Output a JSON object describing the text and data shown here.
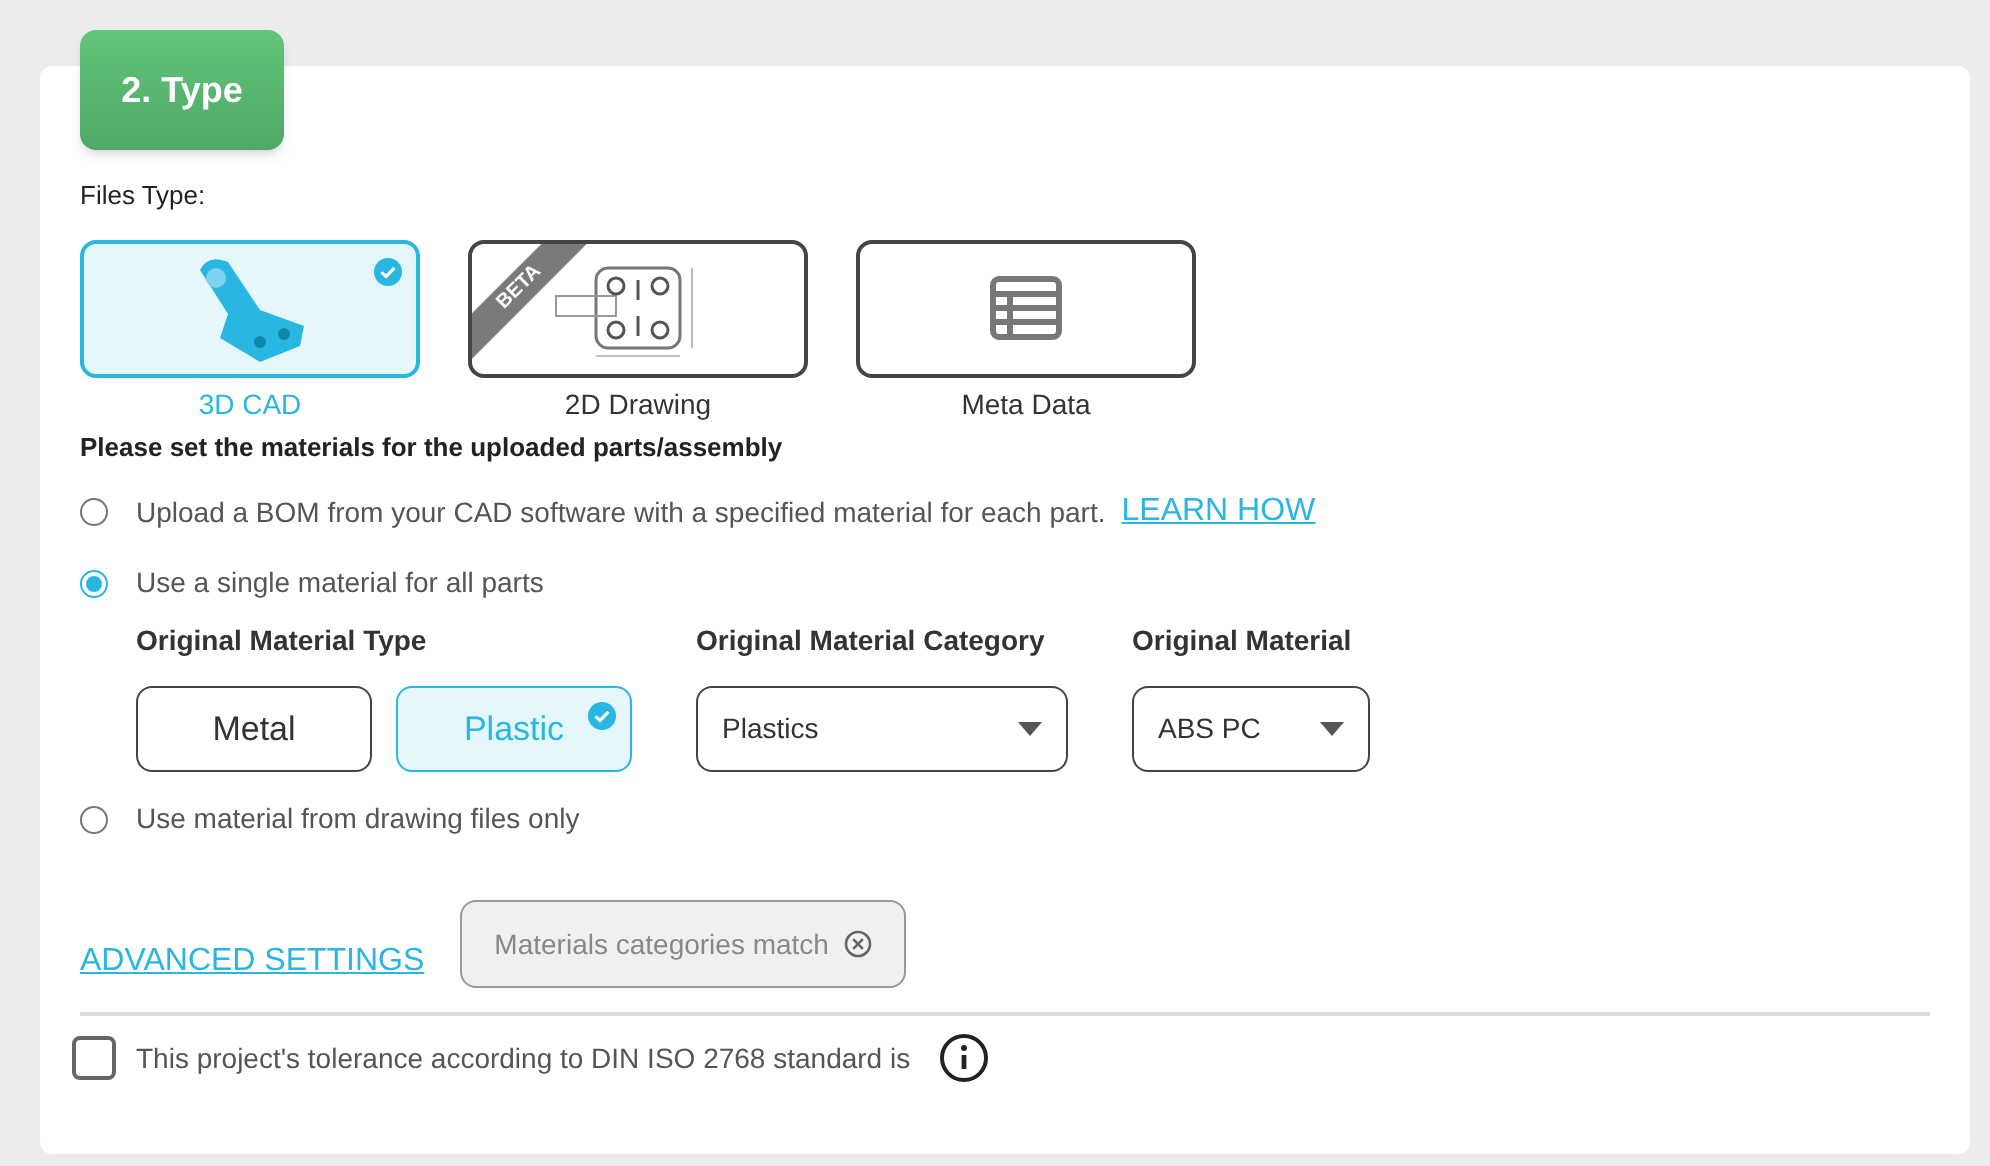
{
  "step_badge": "2. Type",
  "files_type_label": "Files Type:",
  "file_types": [
    {
      "label": "3D CAD",
      "kind": "model",
      "selected": true
    },
    {
      "label": "2D Drawing",
      "kind": "drawing",
      "selected": false,
      "ribbon": "BETA"
    },
    {
      "label": "Meta Data",
      "kind": "table",
      "selected": false
    }
  ],
  "materials_heading": "Please set the materials for the uploaded parts/assembly",
  "options": [
    {
      "label": "Upload a BOM from your CAD software with a specified material for each part.",
      "selected": false,
      "link": "LEARN HOW"
    },
    {
      "label": "Use a single material for all parts",
      "selected": true,
      "material_form": {
        "type_label": "Original Material Type",
        "types": [
          {
            "label": "Metal",
            "selected": false
          },
          {
            "label": "Plastic",
            "selected": true
          }
        ],
        "category_label": "Original Material Category",
        "category_value": "Plastics",
        "material_label": "Original Material",
        "material_value": "ABS PC"
      }
    },
    {
      "label": "Use material from drawing files only",
      "selected": false
    }
  ],
  "advanced_settings": "ADVANCED SETTINGS",
  "chip": "Materials categories match",
  "tolerance": {
    "label": "This project's tolerance according to DIN ISO 2768 standard is",
    "checked": false
  }
}
